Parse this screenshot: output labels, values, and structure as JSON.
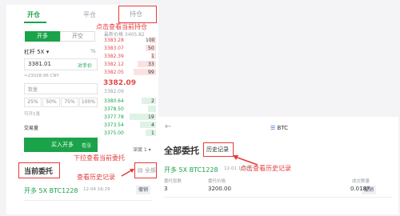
{
  "left": {
    "tabs": [
      "开仓",
      "平仓",
      "持仓"
    ],
    "side": {
      "buy": "开多",
      "sell": "开空"
    },
    "leverage": {
      "label": "杠杆 5X",
      "dd": "▾",
      "pct": "%"
    },
    "price_input": "3381.01",
    "price_btn": "对手价",
    "cny": "≈23028.96 CNY",
    "qty_placeholder": "数量",
    "pcts": [
      "25%",
      "50%",
      "75%",
      "100%"
    ],
    "avail": "可开1张",
    "vol_label": "交易量",
    "buy_btn": "买入开多",
    "buy_sub": "看涨",
    "current_orders": "当前委托",
    "all_label": "全部",
    "order_title": "开多 5X BTC1228",
    "order_time": "12-04 16:29",
    "order_cancel": "撤销",
    "header_avg": "最新价格 3405.82",
    "depth_sell": [
      {
        "price": "3383.28",
        "qty": "100"
      },
      {
        "price": "3383.07",
        "qty": "50"
      },
      {
        "price": "3382.39",
        "qty": "1"
      },
      {
        "price": "3382.12",
        "qty": "33"
      },
      {
        "price": "3382.05",
        "qty": "99"
      }
    ],
    "mid_price": "3382.09",
    "mid_sub": "3382.09",
    "depth_buy": [
      {
        "price": "3380.64",
        "qty": "2"
      },
      {
        "price": "3378.50",
        "qty": ""
      },
      {
        "price": "3377.78",
        "qty": "19"
      },
      {
        "price": "3373.54",
        "qty": "4"
      },
      {
        "price": "3375.00",
        "qty": "1"
      }
    ],
    "depth_ctrl": "深度 1 ▾"
  },
  "right": {
    "back": "←",
    "pair": "BTC",
    "title": "全部委托",
    "history_btn": "历史记录",
    "order_title": "开多 5X BTC1228",
    "order_time": "12-01 16:29",
    "cancel": "撤销",
    "row_labels": [
      "委托张数",
      "委托价格",
      "成交数量"
    ],
    "row_vals": [
      "3",
      "3200.00",
      "0.0187"
    ]
  },
  "annotations": {
    "hold": "点击查看当前持仓",
    "pull_down": "下拉查看当前委托",
    "history_left": "查看历史记录",
    "history_right": "点击查看历史记录"
  },
  "colors": {
    "green": "#1aa34a",
    "red": "#e04848",
    "annot": "#e43b3b"
  }
}
